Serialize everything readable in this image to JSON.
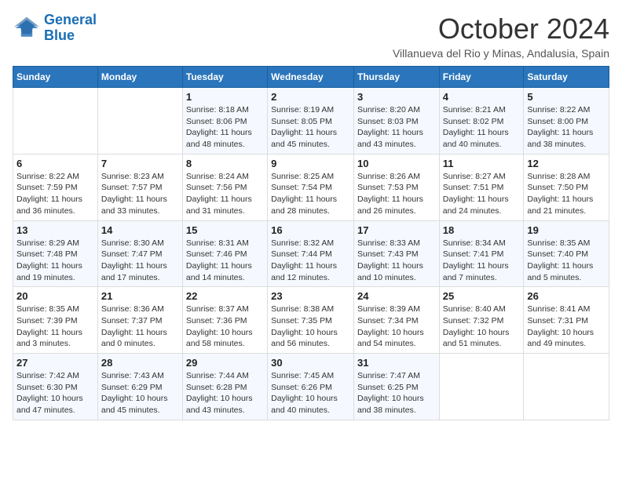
{
  "logo": {
    "line1": "General",
    "line2": "Blue"
  },
  "title": "October 2024",
  "subtitle": "Villanueva del Rio y Minas, Andalusia, Spain",
  "weekdays": [
    "Sunday",
    "Monday",
    "Tuesday",
    "Wednesday",
    "Thursday",
    "Friday",
    "Saturday"
  ],
  "weeks": [
    [
      {
        "day": "",
        "info": ""
      },
      {
        "day": "",
        "info": ""
      },
      {
        "day": "1",
        "info": "Sunrise: 8:18 AM\nSunset: 8:06 PM\nDaylight: 11 hours and 48 minutes."
      },
      {
        "day": "2",
        "info": "Sunrise: 8:19 AM\nSunset: 8:05 PM\nDaylight: 11 hours and 45 minutes."
      },
      {
        "day": "3",
        "info": "Sunrise: 8:20 AM\nSunset: 8:03 PM\nDaylight: 11 hours and 43 minutes."
      },
      {
        "day": "4",
        "info": "Sunrise: 8:21 AM\nSunset: 8:02 PM\nDaylight: 11 hours and 40 minutes."
      },
      {
        "day": "5",
        "info": "Sunrise: 8:22 AM\nSunset: 8:00 PM\nDaylight: 11 hours and 38 minutes."
      }
    ],
    [
      {
        "day": "6",
        "info": "Sunrise: 8:22 AM\nSunset: 7:59 PM\nDaylight: 11 hours and 36 minutes."
      },
      {
        "day": "7",
        "info": "Sunrise: 8:23 AM\nSunset: 7:57 PM\nDaylight: 11 hours and 33 minutes."
      },
      {
        "day": "8",
        "info": "Sunrise: 8:24 AM\nSunset: 7:56 PM\nDaylight: 11 hours and 31 minutes."
      },
      {
        "day": "9",
        "info": "Sunrise: 8:25 AM\nSunset: 7:54 PM\nDaylight: 11 hours and 28 minutes."
      },
      {
        "day": "10",
        "info": "Sunrise: 8:26 AM\nSunset: 7:53 PM\nDaylight: 11 hours and 26 minutes."
      },
      {
        "day": "11",
        "info": "Sunrise: 8:27 AM\nSunset: 7:51 PM\nDaylight: 11 hours and 24 minutes."
      },
      {
        "day": "12",
        "info": "Sunrise: 8:28 AM\nSunset: 7:50 PM\nDaylight: 11 hours and 21 minutes."
      }
    ],
    [
      {
        "day": "13",
        "info": "Sunrise: 8:29 AM\nSunset: 7:48 PM\nDaylight: 11 hours and 19 minutes."
      },
      {
        "day": "14",
        "info": "Sunrise: 8:30 AM\nSunset: 7:47 PM\nDaylight: 11 hours and 17 minutes."
      },
      {
        "day": "15",
        "info": "Sunrise: 8:31 AM\nSunset: 7:46 PM\nDaylight: 11 hours and 14 minutes."
      },
      {
        "day": "16",
        "info": "Sunrise: 8:32 AM\nSunset: 7:44 PM\nDaylight: 11 hours and 12 minutes."
      },
      {
        "day": "17",
        "info": "Sunrise: 8:33 AM\nSunset: 7:43 PM\nDaylight: 11 hours and 10 minutes."
      },
      {
        "day": "18",
        "info": "Sunrise: 8:34 AM\nSunset: 7:41 PM\nDaylight: 11 hours and 7 minutes."
      },
      {
        "day": "19",
        "info": "Sunrise: 8:35 AM\nSunset: 7:40 PM\nDaylight: 11 hours and 5 minutes."
      }
    ],
    [
      {
        "day": "20",
        "info": "Sunrise: 8:35 AM\nSunset: 7:39 PM\nDaylight: 11 hours and 3 minutes."
      },
      {
        "day": "21",
        "info": "Sunrise: 8:36 AM\nSunset: 7:37 PM\nDaylight: 11 hours and 0 minutes."
      },
      {
        "day": "22",
        "info": "Sunrise: 8:37 AM\nSunset: 7:36 PM\nDaylight: 10 hours and 58 minutes."
      },
      {
        "day": "23",
        "info": "Sunrise: 8:38 AM\nSunset: 7:35 PM\nDaylight: 10 hours and 56 minutes."
      },
      {
        "day": "24",
        "info": "Sunrise: 8:39 AM\nSunset: 7:34 PM\nDaylight: 10 hours and 54 minutes."
      },
      {
        "day": "25",
        "info": "Sunrise: 8:40 AM\nSunset: 7:32 PM\nDaylight: 10 hours and 51 minutes."
      },
      {
        "day": "26",
        "info": "Sunrise: 8:41 AM\nSunset: 7:31 PM\nDaylight: 10 hours and 49 minutes."
      }
    ],
    [
      {
        "day": "27",
        "info": "Sunrise: 7:42 AM\nSunset: 6:30 PM\nDaylight: 10 hours and 47 minutes."
      },
      {
        "day": "28",
        "info": "Sunrise: 7:43 AM\nSunset: 6:29 PM\nDaylight: 10 hours and 45 minutes."
      },
      {
        "day": "29",
        "info": "Sunrise: 7:44 AM\nSunset: 6:28 PM\nDaylight: 10 hours and 43 minutes."
      },
      {
        "day": "30",
        "info": "Sunrise: 7:45 AM\nSunset: 6:26 PM\nDaylight: 10 hours and 40 minutes."
      },
      {
        "day": "31",
        "info": "Sunrise: 7:47 AM\nSunset: 6:25 PM\nDaylight: 10 hours and 38 minutes."
      },
      {
        "day": "",
        "info": ""
      },
      {
        "day": "",
        "info": ""
      }
    ]
  ]
}
